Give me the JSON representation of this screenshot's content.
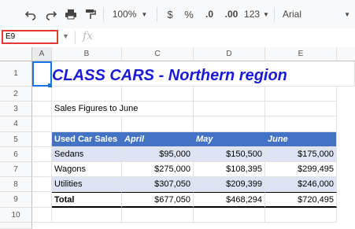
{
  "toolbar": {
    "zoom": "100%",
    "currency": "$",
    "percent": "%",
    "decrease_decimals": ".0",
    "increase_decimals": ".00",
    "more_formats": "123",
    "font": "Arial"
  },
  "formula_bar": {
    "name_box": "E9",
    "fx": "fx"
  },
  "grid": {
    "columns": [
      "A",
      "B",
      "C",
      "D",
      "E"
    ],
    "rows": [
      "1",
      "2",
      "3",
      "4",
      "5",
      "6",
      "7",
      "8",
      "9",
      "10"
    ],
    "title": "CLASS CARS - Northern region",
    "subtitle": "Sales Figures to June",
    "table": {
      "header": [
        "Used Car Sales",
        "April",
        "May",
        "June"
      ],
      "rows": [
        [
          "Sedans",
          "$95,000",
          "$150,500",
          "$175,000"
        ],
        [
          "Wagons",
          "$275,000",
          "$108,395",
          "$299,495"
        ],
        [
          "Utilities",
          "$307,050",
          "$209,399",
          "$246,000"
        ]
      ],
      "total": [
        "Total",
        "$677,050",
        "$468,294",
        "$720,495"
      ]
    }
  },
  "colors": {
    "header_fill": "#4472c4",
    "band_fill": "#dde3f3",
    "title_color": "#1a1ad6",
    "highlight_border": "#e53935"
  }
}
